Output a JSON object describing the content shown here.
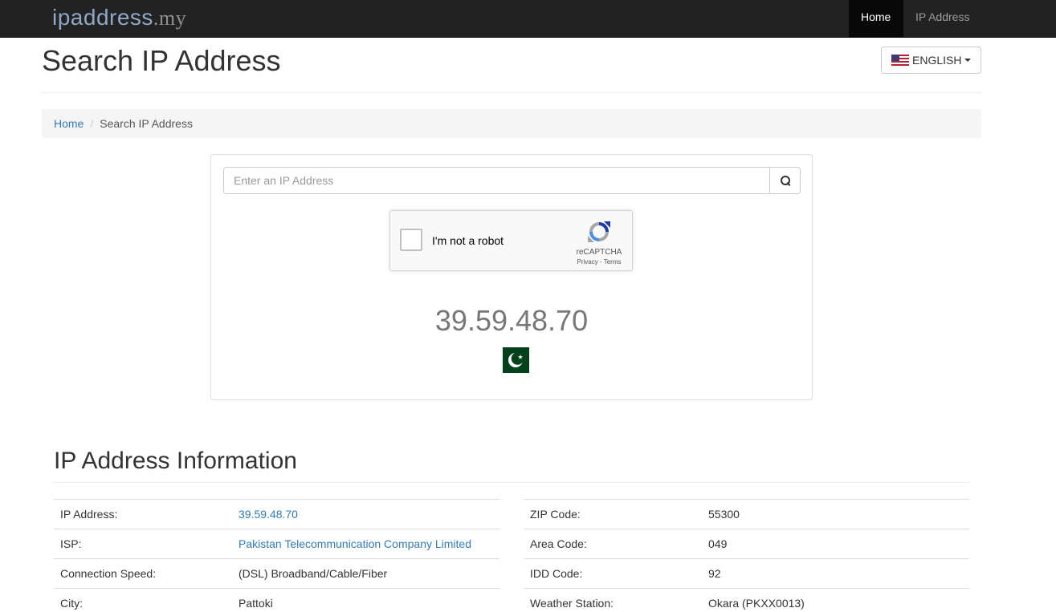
{
  "nav": {
    "brand_main": "ipaddress",
    "brand_tld": ".my",
    "home": "Home",
    "ip_address": "IP Address"
  },
  "header": {
    "title": "Search IP Address",
    "language": "ENGLISH"
  },
  "breadcrumb": {
    "home": "Home",
    "current": "Search IP Address"
  },
  "search": {
    "placeholder": "Enter an IP Address",
    "value": ""
  },
  "recaptcha": {
    "label": "I'm not a robot",
    "brand": "reCAPTCHA",
    "links": "Privacy - Terms"
  },
  "result": {
    "ip": "39.59.48.70",
    "flag": "pakistan-flag"
  },
  "info": {
    "title": "IP Address Information",
    "left": [
      {
        "label": "IP Address:",
        "value": "39.59.48.70"
      },
      {
        "label": "ISP:",
        "value": "Pakistan Telecommunication Company Limited"
      },
      {
        "label": "Connection Speed:",
        "value": "(DSL) Broadband/Cable/Fiber"
      },
      {
        "label": "City:",
        "value": "Pattoki"
      }
    ],
    "right": [
      {
        "label": "ZIP Code:",
        "value": "55300"
      },
      {
        "label": "Area Code:",
        "value": "049"
      },
      {
        "label": "IDD Code:",
        "value": "92"
      },
      {
        "label": "Weather Station:",
        "value": "Okara (PKXX0013)"
      }
    ]
  },
  "colors": {
    "navbar": "#222222",
    "link": "#337ab7",
    "pk_green": "#01411c"
  }
}
